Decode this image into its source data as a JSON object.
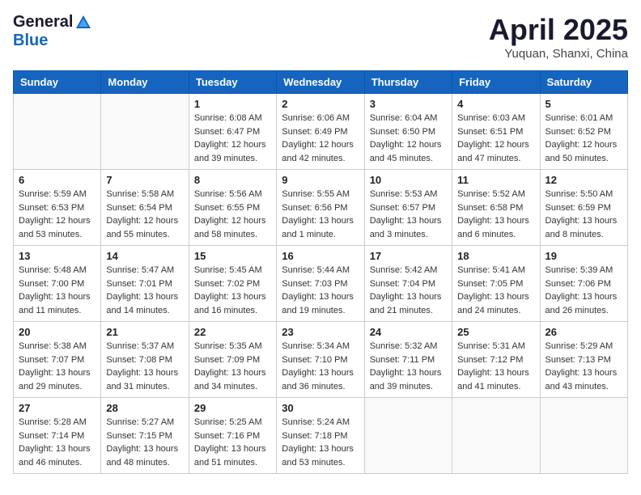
{
  "header": {
    "logo_general": "General",
    "logo_blue": "Blue",
    "title": "April 2025",
    "subtitle": "Yuquan, Shanxi, China"
  },
  "calendar": {
    "weekdays": [
      "Sunday",
      "Monday",
      "Tuesday",
      "Wednesday",
      "Thursday",
      "Friday",
      "Saturday"
    ],
    "weeks": [
      [
        {
          "day": null,
          "sunrise": null,
          "sunset": null,
          "daylight": null
        },
        {
          "day": null,
          "sunrise": null,
          "sunset": null,
          "daylight": null
        },
        {
          "day": "1",
          "sunrise": "Sunrise: 6:08 AM",
          "sunset": "Sunset: 6:47 PM",
          "daylight": "Daylight: 12 hours and 39 minutes."
        },
        {
          "day": "2",
          "sunrise": "Sunrise: 6:06 AM",
          "sunset": "Sunset: 6:49 PM",
          "daylight": "Daylight: 12 hours and 42 minutes."
        },
        {
          "day": "3",
          "sunrise": "Sunrise: 6:04 AM",
          "sunset": "Sunset: 6:50 PM",
          "daylight": "Daylight: 12 hours and 45 minutes."
        },
        {
          "day": "4",
          "sunrise": "Sunrise: 6:03 AM",
          "sunset": "Sunset: 6:51 PM",
          "daylight": "Daylight: 12 hours and 47 minutes."
        },
        {
          "day": "5",
          "sunrise": "Sunrise: 6:01 AM",
          "sunset": "Sunset: 6:52 PM",
          "daylight": "Daylight: 12 hours and 50 minutes."
        }
      ],
      [
        {
          "day": "6",
          "sunrise": "Sunrise: 5:59 AM",
          "sunset": "Sunset: 6:53 PM",
          "daylight": "Daylight: 12 hours and 53 minutes."
        },
        {
          "day": "7",
          "sunrise": "Sunrise: 5:58 AM",
          "sunset": "Sunset: 6:54 PM",
          "daylight": "Daylight: 12 hours and 55 minutes."
        },
        {
          "day": "8",
          "sunrise": "Sunrise: 5:56 AM",
          "sunset": "Sunset: 6:55 PM",
          "daylight": "Daylight: 12 hours and 58 minutes."
        },
        {
          "day": "9",
          "sunrise": "Sunrise: 5:55 AM",
          "sunset": "Sunset: 6:56 PM",
          "daylight": "Daylight: 13 hours and 1 minute."
        },
        {
          "day": "10",
          "sunrise": "Sunrise: 5:53 AM",
          "sunset": "Sunset: 6:57 PM",
          "daylight": "Daylight: 13 hours and 3 minutes."
        },
        {
          "day": "11",
          "sunrise": "Sunrise: 5:52 AM",
          "sunset": "Sunset: 6:58 PM",
          "daylight": "Daylight: 13 hours and 6 minutes."
        },
        {
          "day": "12",
          "sunrise": "Sunrise: 5:50 AM",
          "sunset": "Sunset: 6:59 PM",
          "daylight": "Daylight: 13 hours and 8 minutes."
        }
      ],
      [
        {
          "day": "13",
          "sunrise": "Sunrise: 5:48 AM",
          "sunset": "Sunset: 7:00 PM",
          "daylight": "Daylight: 13 hours and 11 minutes."
        },
        {
          "day": "14",
          "sunrise": "Sunrise: 5:47 AM",
          "sunset": "Sunset: 7:01 PM",
          "daylight": "Daylight: 13 hours and 14 minutes."
        },
        {
          "day": "15",
          "sunrise": "Sunrise: 5:45 AM",
          "sunset": "Sunset: 7:02 PM",
          "daylight": "Daylight: 13 hours and 16 minutes."
        },
        {
          "day": "16",
          "sunrise": "Sunrise: 5:44 AM",
          "sunset": "Sunset: 7:03 PM",
          "daylight": "Daylight: 13 hours and 19 minutes."
        },
        {
          "day": "17",
          "sunrise": "Sunrise: 5:42 AM",
          "sunset": "Sunset: 7:04 PM",
          "daylight": "Daylight: 13 hours and 21 minutes."
        },
        {
          "day": "18",
          "sunrise": "Sunrise: 5:41 AM",
          "sunset": "Sunset: 7:05 PM",
          "daylight": "Daylight: 13 hours and 24 minutes."
        },
        {
          "day": "19",
          "sunrise": "Sunrise: 5:39 AM",
          "sunset": "Sunset: 7:06 PM",
          "daylight": "Daylight: 13 hours and 26 minutes."
        }
      ],
      [
        {
          "day": "20",
          "sunrise": "Sunrise: 5:38 AM",
          "sunset": "Sunset: 7:07 PM",
          "daylight": "Daylight: 13 hours and 29 minutes."
        },
        {
          "day": "21",
          "sunrise": "Sunrise: 5:37 AM",
          "sunset": "Sunset: 7:08 PM",
          "daylight": "Daylight: 13 hours and 31 minutes."
        },
        {
          "day": "22",
          "sunrise": "Sunrise: 5:35 AM",
          "sunset": "Sunset: 7:09 PM",
          "daylight": "Daylight: 13 hours and 34 minutes."
        },
        {
          "day": "23",
          "sunrise": "Sunrise: 5:34 AM",
          "sunset": "Sunset: 7:10 PM",
          "daylight": "Daylight: 13 hours and 36 minutes."
        },
        {
          "day": "24",
          "sunrise": "Sunrise: 5:32 AM",
          "sunset": "Sunset: 7:11 PM",
          "daylight": "Daylight: 13 hours and 39 minutes."
        },
        {
          "day": "25",
          "sunrise": "Sunrise: 5:31 AM",
          "sunset": "Sunset: 7:12 PM",
          "daylight": "Daylight: 13 hours and 41 minutes."
        },
        {
          "day": "26",
          "sunrise": "Sunrise: 5:29 AM",
          "sunset": "Sunset: 7:13 PM",
          "daylight": "Daylight: 13 hours and 43 minutes."
        }
      ],
      [
        {
          "day": "27",
          "sunrise": "Sunrise: 5:28 AM",
          "sunset": "Sunset: 7:14 PM",
          "daylight": "Daylight: 13 hours and 46 minutes."
        },
        {
          "day": "28",
          "sunrise": "Sunrise: 5:27 AM",
          "sunset": "Sunset: 7:15 PM",
          "daylight": "Daylight: 13 hours and 48 minutes."
        },
        {
          "day": "29",
          "sunrise": "Sunrise: 5:25 AM",
          "sunset": "Sunset: 7:16 PM",
          "daylight": "Daylight: 13 hours and 51 minutes."
        },
        {
          "day": "30",
          "sunrise": "Sunrise: 5:24 AM",
          "sunset": "Sunset: 7:18 PM",
          "daylight": "Daylight: 13 hours and 53 minutes."
        },
        {
          "day": null,
          "sunrise": null,
          "sunset": null,
          "daylight": null
        },
        {
          "day": null,
          "sunrise": null,
          "sunset": null,
          "daylight": null
        },
        {
          "day": null,
          "sunrise": null,
          "sunset": null,
          "daylight": null
        }
      ]
    ]
  }
}
